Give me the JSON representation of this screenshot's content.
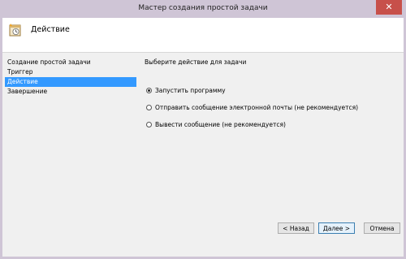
{
  "window": {
    "title": "Мастер создания простой задачи",
    "close_glyph": "✕"
  },
  "header": {
    "title": "Действие",
    "icon": "task-wizard-icon"
  },
  "sidebar": {
    "items": [
      {
        "label": "Создание простой задачи",
        "active": false
      },
      {
        "label": "Триггер",
        "active": false
      },
      {
        "label": "Действие",
        "active": true
      },
      {
        "label": "Завершение",
        "active": false
      }
    ]
  },
  "main": {
    "prompt": "Выберите действие для задачи",
    "options": [
      {
        "label": "Запустить программу",
        "checked": true
      },
      {
        "label": "Отправить сообщение электронной почты (не рекомендуется)",
        "checked": false
      },
      {
        "label": "Вывести сообщение (не рекомендуется)",
        "checked": false
      }
    ]
  },
  "buttons": {
    "back": "< Назад",
    "next": "Далее >",
    "cancel": "Отмена"
  },
  "colors": {
    "selection": "#3399ff",
    "close_button": "#c7504a",
    "window_frame": "#cfc5d6"
  }
}
